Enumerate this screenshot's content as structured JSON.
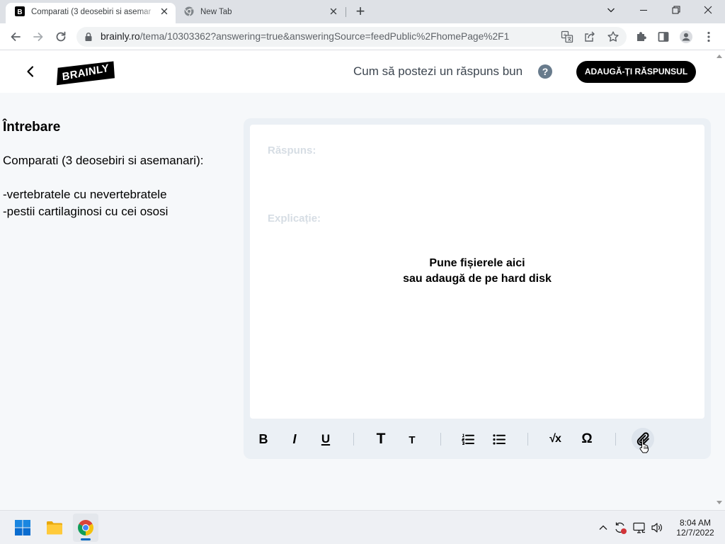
{
  "colors": {
    "brand_black": "#000000",
    "help_icon_bg": "#687b8c",
    "editor_panel_bg": "#ebf0f5",
    "placeholder_text": "#d6dde4",
    "taskbar_active_indicator": "#0067c0"
  },
  "browser": {
    "tabs": [
      {
        "title": "Comparati (3 deosebiri si asemar",
        "favicon_letter": "B",
        "icon": "brainly-favicon",
        "active": true
      },
      {
        "title": "New Tab",
        "icon": "chrome-gray-icon",
        "active": false
      }
    ],
    "new_tab_label": "+",
    "window_controls": [
      "tab-search-icon",
      "minimize-icon",
      "restore-icon",
      "close-icon"
    ],
    "nav_icons": [
      "back-arrow-icon",
      "forward-arrow-icon",
      "reload-icon"
    ],
    "address_bar": {
      "host": "brainly.ro",
      "path": "/tema/10303362?answering=true&answeringSource=feedPublic%2FhomePage%2F1",
      "secure_icon": "lock-icon",
      "action_icons": [
        "translate-icon",
        "share-icon",
        "bookmark-star-icon"
      ]
    },
    "extension_icons": [
      "extensions-puzzle-icon",
      "side-panel-icon",
      "profile-icon",
      "menu-kebab-icon"
    ]
  },
  "page": {
    "header": {
      "back_icon": "chevron-left-icon",
      "logo_text": "BRAINLY",
      "help_link": "Cum să postezi un răspuns bun",
      "help_icon_glyph": "?",
      "submit_button": "ADAUGĂ-ȚI RĂSPUNSUL"
    },
    "question": {
      "heading": "Întrebare",
      "lines": [
        "Comparati (3 deosebiri si asemanari):",
        "-vertebratele cu nevertebratele",
        "-pestii cartilaginosi cu cei ososi"
      ]
    },
    "editor": {
      "answer_placeholder": "Răspuns:",
      "explanation_placeholder": "Explicație:",
      "dropzone": {
        "line1": "Pune fișierele aici",
        "line2": "sau adaugă de pe hard disk"
      },
      "toolbar": [
        {
          "action": "bold",
          "glyph": "B",
          "icon": "bold-icon"
        },
        {
          "action": "italic",
          "glyph": "I",
          "icon": "italic-icon"
        },
        {
          "action": "underline",
          "glyph": "U",
          "icon": "underline-icon"
        },
        {
          "action": "heading",
          "glyph": "T",
          "icon": "heading-icon"
        },
        {
          "action": "subheading",
          "glyph": "T",
          "icon": "subheading-icon"
        },
        {
          "action": "ordered-list",
          "icon": "ordered-list-icon"
        },
        {
          "action": "unordered-list",
          "icon": "unordered-list-icon"
        },
        {
          "action": "math",
          "glyph": "√x",
          "icon": "math-formula-icon"
        },
        {
          "action": "symbol",
          "glyph": "Ω",
          "icon": "special-symbol-icon"
        },
        {
          "action": "attach",
          "icon": "paperclip-attach-icon",
          "hovered": true
        }
      ]
    }
  },
  "taskbar": {
    "apps": [
      "windows-start-icon",
      "file-explorer-icon",
      "chrome-icon"
    ],
    "active_app": "chrome-icon",
    "tray_icons": [
      "show-hidden-icons-chevron",
      "sync-alert-icon",
      "network-monitor-icon",
      "volume-icon"
    ],
    "time": "8:04 AM",
    "date": "12/7/2022"
  }
}
